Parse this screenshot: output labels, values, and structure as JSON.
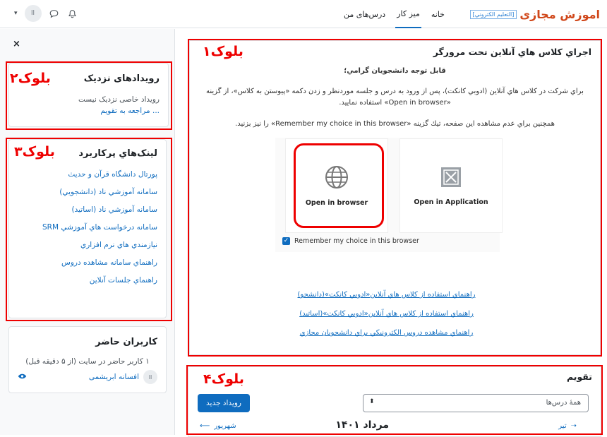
{
  "header": {
    "logo_main": "اموزش مجازی",
    "logo_sub": "[التعليم الكتروني]",
    "nav": [
      "خانه",
      "میز کار",
      "درس‌های من"
    ],
    "avatar_initial": "اا"
  },
  "drawer": {
    "close_symbol": "×",
    "events": {
      "title": "رویدادهای نزدیک",
      "empty": "رویداد خاصی نزدیک نیست",
      "link": "... مراجعه به تقویم"
    },
    "links": {
      "title": "لینک‌هاي پركاربرد",
      "items": [
        "پورتال دانشگاه قرآن و حدیث",
        "سامانه آموزشي ناد (دانشجويي)",
        "سامانه آموزشي ناد (اساتيد)",
        "سامانه درخواست هاي آموزشي SRM",
        "نيازمندي هاي نرم افزاري",
        "راهنماي سامانه مشاهده دروس",
        "راهنماي جلسات آنلاين"
      ]
    },
    "online": {
      "title": "کاربران حاضر",
      "count_text": "۱ کاربر حاضر در سایت (از ۵ دقیقه قبل)",
      "user_name": "افسانه ابریشمی",
      "user_initial": "اا"
    }
  },
  "labels": {
    "block1": "بلوک۱",
    "block2": "بلوک۲",
    "block3": "بلوک۳",
    "block4": "بلوک۴"
  },
  "main": {
    "title": "اجراي كلاس هاي آنلاين تحت مرورگر",
    "subtitle": "قابل توجه دانشجويان گرامي؛",
    "para1_line1": "براي شركت در كلاس هاي آنلاين (ادوبي كانكت)، پس از ورود به درس و جلسه موردنظر و زدن دكمه «پيوستن به كلاس»، از گزينه",
    "para1_line2": "«Open in browser» استفاده نماييد.",
    "para2": "همچنين براي عدم مشاهده اين صفحه، تيك گزينه «Remember my choice in this browser» را نيز بزنيد.",
    "open_browser": "Open in browser",
    "open_app": "Open in Application",
    "remember": "Remember my choice in this browser",
    "links": [
      "راهنماي استفاده از كلاس هاي آنلاين«ادوبي كانكت»(دانشجو)",
      "راهنماي استفاده از كلاس هاي آنلاين«ادوبي كانكت»(اساتيد)",
      "راهنماي مشاهده دروس الكترونيكي براي دانشجويان مجازي"
    ]
  },
  "calendar": {
    "title": "تقویم",
    "course_select": "همهٔ درس‌ها",
    "new_event": "رویداد جدید",
    "month": "مرداد ۱۴۰۱",
    "prev_month": "تیر",
    "next_month": "شهریور"
  },
  "colors": {
    "accent": "#0f6cbf",
    "annotation_red": "#e00000"
  }
}
